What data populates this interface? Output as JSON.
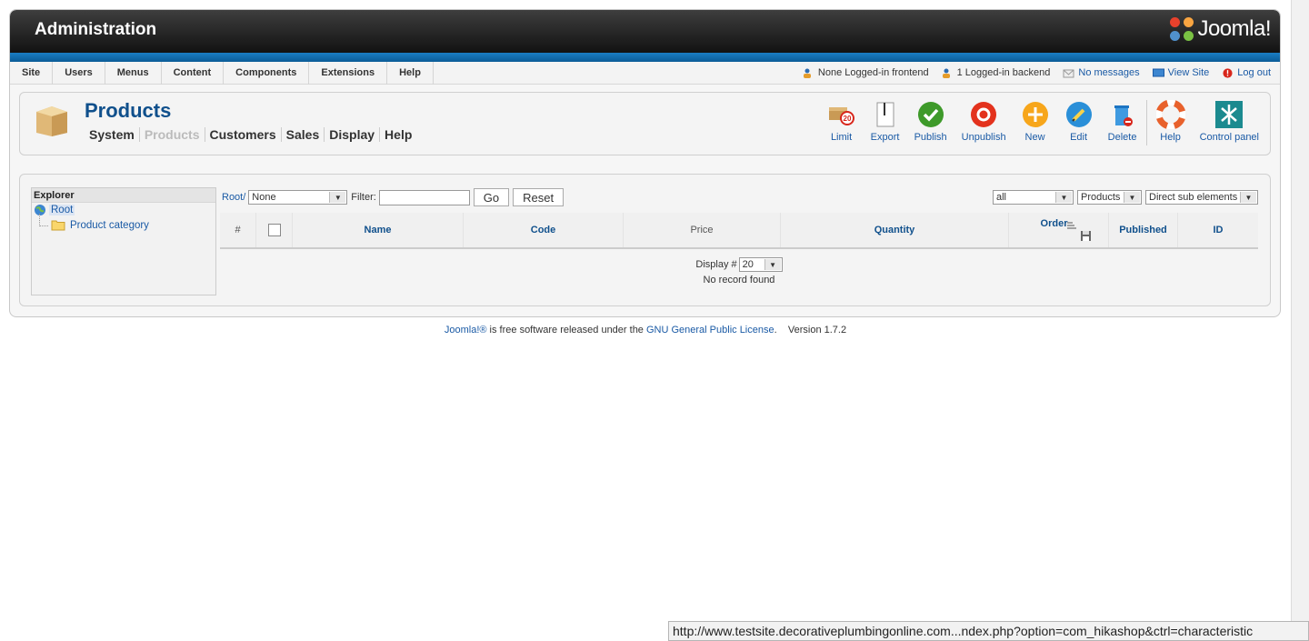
{
  "header": {
    "title": "Administration",
    "logo_text": "Joomla!"
  },
  "menu": [
    "Site",
    "Users",
    "Menus",
    "Content",
    "Components",
    "Extensions",
    "Help"
  ],
  "status": {
    "frontend": "None Logged-in frontend",
    "backend": "1 Logged-in backend",
    "messages": "No messages",
    "view_site": "View Site",
    "logout": "Log out"
  },
  "page": {
    "title": "Products",
    "subnav": [
      "System",
      "Products",
      "Customers",
      "Sales",
      "Display",
      "Help"
    ]
  },
  "toolbar": [
    "Limit",
    "Export",
    "Publish",
    "Unpublish",
    "New",
    "Edit",
    "Delete",
    "Help",
    "Control panel"
  ],
  "explorer": {
    "title": "Explorer",
    "root": "Root",
    "child": "Product category"
  },
  "filters": {
    "breadcrumb": "Root/",
    "category_select": "None",
    "filter_label": "Filter:",
    "go": "Go",
    "reset": "Reset",
    "publish_select": "all",
    "type_select": "Products",
    "depth_select": "Direct sub elements"
  },
  "table": {
    "columns": [
      "#",
      "",
      "Name",
      "Code",
      "Price",
      "Quantity",
      "Order",
      "Published",
      "ID"
    ],
    "display_label": "Display #",
    "display_value": "20",
    "empty": "No record found"
  },
  "footer": {
    "joomla": "Joomla!®",
    "text1": " is free software released under the ",
    "license": "GNU General Public License",
    "version": "Version 1.7.2"
  },
  "statusbar": {
    "url": "http://www.testsite.decorativeplumbingonline.com...ndex.php?option=com_hikashop&ctrl=characteristic"
  },
  "colors": {
    "link": "#1a5aa5",
    "title": "#10508c",
    "header": "#1e1e1e",
    "accent": "#0b5c97"
  }
}
